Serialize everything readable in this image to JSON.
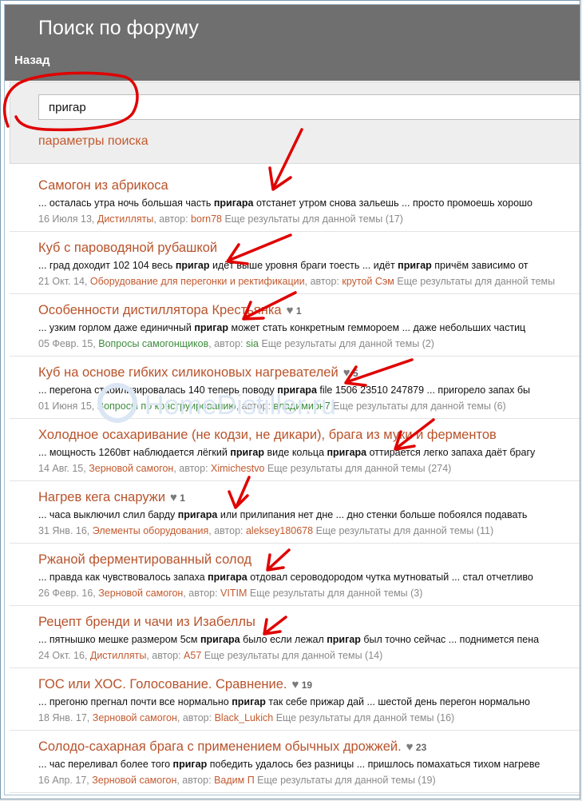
{
  "page": {
    "title": "Поиск по форуму",
    "back_label": "Назад"
  },
  "search": {
    "value": "пригар",
    "params_label": "параметры поиска"
  },
  "watermark_text": "HomeDistiller.ru",
  "results": [
    {
      "title": "Самогон из абрикоса",
      "likes": "",
      "snippet_before": "... осталась утра ночь большая часть ",
      "snippet_bold": "пригара",
      "snippet_after": " отстанет утром снова зальешь ... просто промоешь хорошо",
      "date": "16 Июля 13,",
      "category": "Дистилляты",
      "author_label": ", автор: ",
      "author": "born78",
      "more": "Еще результаты для данной темы (17)"
    },
    {
      "title": "Куб с пароводяной рубашкой",
      "likes": "",
      "snippet_before": "... град доходит 102 104 весь ",
      "snippet_bold": "пригар",
      "snippet_after": " идёт выше уровня браги тоесть ... идёт ",
      "snippet_bold2": "пригар",
      "snippet_after2": " причём зависимо от",
      "date": "21 Окт. 14,",
      "category": "Оборудование для перегонки и ректификации",
      "author_label": ", автор: ",
      "author": "крутой Сэм",
      "more": "Еще результаты для данной темы"
    },
    {
      "title": "Особенности дистиллятора Крестьянка",
      "likes": "1",
      "snippet_before": "... узким горлом даже единичный ",
      "snippet_bold": "пригар",
      "snippet_after": " может стать конкретным геммороем ... даже небольших частиц",
      "date": "05 Февр. 15,",
      "category": "Вопросы самогонщиков",
      "author_label": ", автор: ",
      "author": "sia",
      "more": "Еще результаты для данной темы (2)"
    },
    {
      "title": "Куб на основе гибких силиконовых нагревателей",
      "likes": "5",
      "snippet_before": "... перегона стабилизировалась 140 теперь поводу ",
      "snippet_bold": "пригара",
      "snippet_after": " file 1506 23510 247879 ... пригорело запах бы",
      "date": "01 Июня 15,",
      "category": "Вопросы по конструированию",
      "author_label": ", автор: ",
      "author": "владимирн7",
      "more": "Еще результаты для данной темы (6)"
    },
    {
      "title": "Холодное осахаривание (не кодзи, не дикари), брага из муки и ферментов",
      "likes": "",
      "snippet_before": "... мощность 1260вт наблюдается лёгкий ",
      "snippet_bold": "пригар",
      "snippet_after": " виде кольца ",
      "snippet_bold2": "пригара",
      "snippet_after2": " оттирается легко запаха даёт брагу",
      "date": "14 Авг. 15,",
      "category": "Зерновой самогон",
      "author_label": ", автор: ",
      "author": "Ximichestvo",
      "more": "Еще результаты для данной темы (274)"
    },
    {
      "title": "Нагрев кега снаружи",
      "likes": "1",
      "snippet_before": "... часа выключил слил барду ",
      "snippet_bold": "пригара",
      "snippet_after": " или прилипания нет дне ... дно стенки больше побоялся подавать",
      "date": "31 Янв. 16,",
      "category": "Элементы оборудования",
      "author_label": ", автор: ",
      "author": "aleksey180678",
      "more": "Еще результаты для данной темы (11)"
    },
    {
      "title": "Ржаной ферментированный солод",
      "likes": "",
      "snippet_before": "... правда как чувствовалось запаха ",
      "snippet_bold": "пригара",
      "snippet_after": " отдовал сероводородом чутка мутноватый ... стал отчетливо",
      "date": "26 Февр. 16,",
      "category": "Зерновой самогон",
      "author_label": ", автор: ",
      "author": "VITIM",
      "more": "Еще результаты для данной темы (3)"
    },
    {
      "title": "Рецепт бренди и чачи из Изабеллы",
      "likes": "",
      "snippet_before": "... пятнышко мешке размером 5см ",
      "snippet_bold": "пригара",
      "snippet_after": " было если лежал ",
      "snippet_bold2": "пригар",
      "snippet_after2": " был точно сейчас ... поднимется пена",
      "date": "24 Окт. 16,",
      "category": "Дистилляты",
      "author_label": ", автор: ",
      "author": "A57",
      "more": "Еще результаты для данной темы (14)"
    },
    {
      "title": "ГОС или ХОС. Голосование. Сравнение.",
      "likes": "19",
      "snippet_before": "... прегоню прегнал почти все нормально ",
      "snippet_bold": "пригар",
      "snippet_after": " так себе прижар дай ... шестой день перегон нормально",
      "date": "18 Янв. 17,",
      "category": "Зерновой самогон",
      "author_label": ", автор: ",
      "author": "Black_Lukich",
      "more": "Еще результаты для данной темы (16)"
    },
    {
      "title": "Солодо-сахарная брага с применением обычных дрожжей.",
      "likes": "23",
      "snippet_before": "... час переливал более того ",
      "snippet_bold": "пригар",
      "snippet_after": " победить удалось без разницы ... пришлось помахаться тихом нагреве",
      "date": "16 Апр. 17,",
      "category": "Зерновой самогон",
      "author_label": ", автор: ",
      "author": "Вадим П",
      "more": "Еще результаты для данной темы (19)"
    }
  ],
  "colors": {
    "header_bg": "#6f6f6f",
    "link": "#b8532b",
    "green_link": "#3d8c3d",
    "annotation": "#e00000"
  },
  "icons": {
    "like": "heart-icon"
  }
}
